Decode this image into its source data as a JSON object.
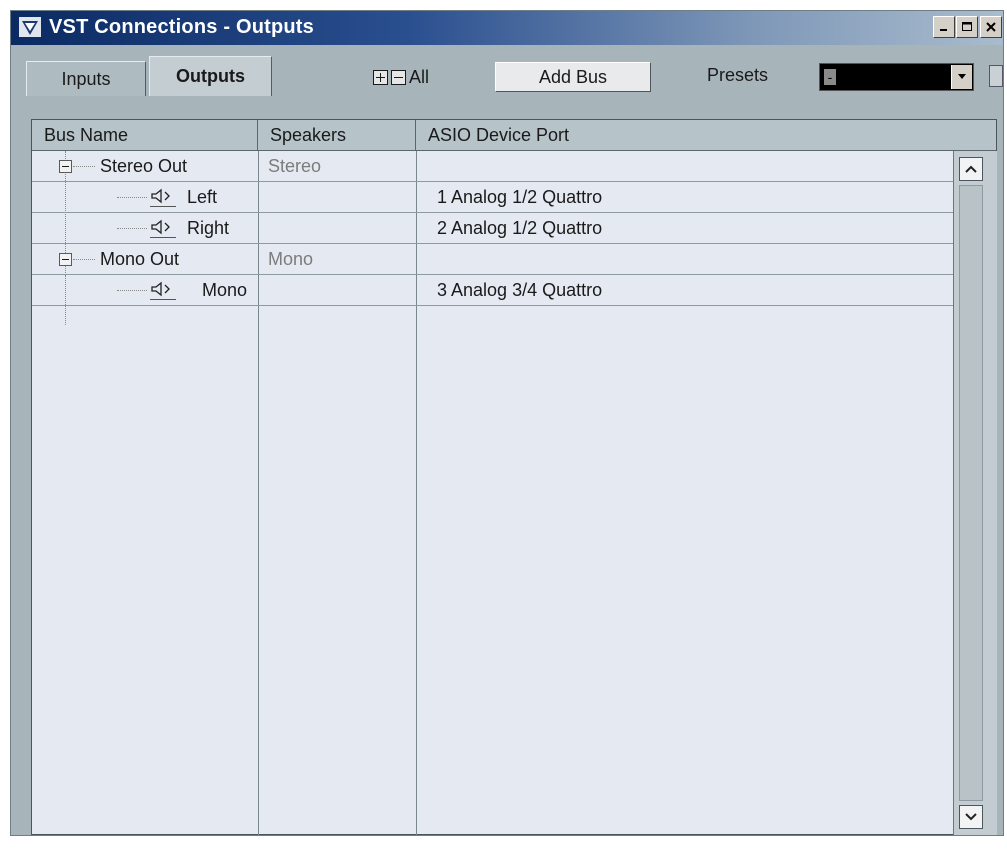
{
  "window": {
    "title": "VST Connections - Outputs",
    "app_icon": "cubase-logo-icon",
    "controls": [
      "minimize-icon",
      "maximize-icon",
      "close-icon"
    ]
  },
  "tabs": [
    {
      "label": "Inputs",
      "active": false
    },
    {
      "label": "Outputs",
      "active": true
    }
  ],
  "toolbar": {
    "expand_all_label": "All",
    "add_bus_label": "Add Bus",
    "presets_label": "Presets",
    "presets_value": "-"
  },
  "table": {
    "headers": [
      "Bus Name",
      "Speakers",
      "ASIO Device Port"
    ],
    "rows": [
      {
        "name": "Stereo Out",
        "speakers": "Stereo",
        "port": "",
        "level": 0
      },
      {
        "name": "Left",
        "speakers": "",
        "port": "1 Analog 1/2 Quattro",
        "level": 1
      },
      {
        "name": "Right",
        "speakers": "",
        "port": "2 Analog 1/2 Quattro",
        "level": 1
      },
      {
        "name": "Mono Out",
        "speakers": "Mono",
        "port": "",
        "level": 0
      },
      {
        "name": "Mono",
        "speakers": "",
        "port": "3 Analog 3/4 Quattro",
        "level": 1
      }
    ]
  },
  "colors": {
    "title_bar_start": "#0b2a63",
    "window_bg": "#a7b5bb",
    "table_bg": "#e5e9f2",
    "speaker_text": "#7c7c7c"
  }
}
